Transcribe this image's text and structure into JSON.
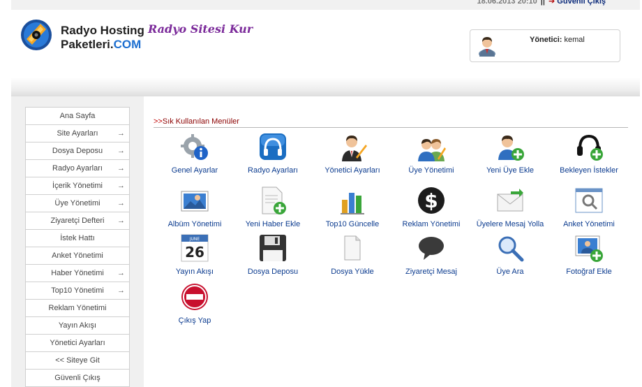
{
  "top_bar": {
    "date": "18.06.2013 20:10",
    "separator": "||",
    "logout_label": "Güvenli Çıkış"
  },
  "header": {
    "brand_line1": "Radyo Hosting",
    "brand_line2": "Paketleri.",
    "brand_com": "COM",
    "tagline": "Radyo Sitesi Kur",
    "user_label": "Yönetici:",
    "user_name": "kemal"
  },
  "sidebar": {
    "items": [
      {
        "label": "Ana Sayfa",
        "chev": false
      },
      {
        "label": "Site Ayarları",
        "chev": true
      },
      {
        "label": "Dosya Deposu",
        "chev": true
      },
      {
        "label": "Radyo Ayarları",
        "chev": true
      },
      {
        "label": "İçerik Yönetimi",
        "chev": true
      },
      {
        "label": "Üye Yönetimi",
        "chev": true
      },
      {
        "label": "Ziyaretçi Defteri",
        "chev": true
      },
      {
        "label": "İstek Hattı",
        "chev": false
      },
      {
        "label": "Anket Yönetimi",
        "chev": false
      },
      {
        "label": "Haber Yönetimi",
        "chev": true
      },
      {
        "label": "Top10 Yönetimi",
        "chev": true
      },
      {
        "label": "Reklam Yönetimi",
        "chev": false
      },
      {
        "label": "Yayın Akışı",
        "chev": false
      },
      {
        "label": "Yönetici Ayarları",
        "chev": false
      },
      {
        "label": "<< Siteye Git",
        "chev": false
      },
      {
        "label": "Güvenli Çıkış",
        "chev": false
      }
    ]
  },
  "main": {
    "section_prefix": ">>",
    "section_title": "Sık Kullanılan Menüler",
    "tiles": [
      {
        "label": "Genel Ayarlar",
        "icon": "settings-gear-info-icon"
      },
      {
        "label": "Radyo Ayarları",
        "icon": "headphones-app-icon"
      },
      {
        "label": "Yönetici Ayarları",
        "icon": "admin-user-edit-icon"
      },
      {
        "label": "Üye Yönetimi",
        "icon": "users-edit-icon"
      },
      {
        "label": "Yeni Üye Ekle",
        "icon": "user-add-icon"
      },
      {
        "label": "Bekleyen İstekler",
        "icon": "headset-add-icon"
      },
      {
        "label": "Albüm Yönetimi",
        "icon": "photo-album-icon"
      },
      {
        "label": "Yeni Haber Ekle",
        "icon": "document-add-icon"
      },
      {
        "label": "Top10 Güncelle",
        "icon": "bar-chart-icon"
      },
      {
        "label": "Reklam Yönetimi",
        "icon": "dollar-icon"
      },
      {
        "label": "Üyelere Mesaj Yolla",
        "icon": "envelope-icon"
      },
      {
        "label": "Anket Yönetimi",
        "icon": "search-window-icon"
      },
      {
        "label": "Yayın Akışı",
        "icon": "calendar-icon",
        "calendar_month": "JUNE",
        "calendar_day": "26"
      },
      {
        "label": "Dosya Deposu",
        "icon": "floppy-disk-icon"
      },
      {
        "label": "Dosya Yükle",
        "icon": "file-icon"
      },
      {
        "label": "Ziyaretçi Mesaj",
        "icon": "speech-bubble-icon"
      },
      {
        "label": "Üye Ara",
        "icon": "magnifier-icon"
      },
      {
        "label": "Fotoğraf Ekle",
        "icon": "photo-add-icon"
      },
      {
        "label": "Çıkış Yap",
        "icon": "stop-exit-icon"
      }
    ]
  },
  "colors": {
    "link_blue": "#0b3b8f",
    "section_red": "#8b0000",
    "brand_purple": "#7b2a9a",
    "sidebar_bg": "#f0f0f0"
  }
}
